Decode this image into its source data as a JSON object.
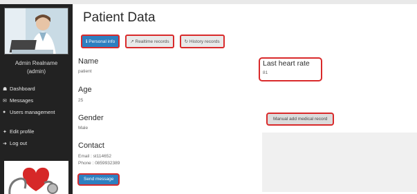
{
  "sidebar": {
    "admin_name_line1": "Admin Realname",
    "admin_name_line2": "(admin)",
    "items": [
      {
        "label": "Dashboard",
        "icon": "home-icon"
      },
      {
        "label": "Messages",
        "icon": "envelope-icon"
      },
      {
        "label": "Users management",
        "icon": "users-icon"
      },
      {
        "label": "Edit profile",
        "icon": "wrench-icon"
      },
      {
        "label": "Log out",
        "icon": "logout-icon"
      }
    ]
  },
  "main": {
    "title": "Patient Data",
    "tabs": [
      {
        "label": "Personal info",
        "icon": "info-icon",
        "active": true
      },
      {
        "label": "Realtime records",
        "icon": "chart-icon",
        "active": false
      },
      {
        "label": "History records",
        "icon": "history-icon",
        "active": false
      }
    ],
    "fields": {
      "name_label": "Name",
      "name_value": "patient",
      "age_label": "Age",
      "age_value": "25",
      "gender_label": "Gender",
      "gender_value": "Male",
      "contact_label": "Contact",
      "email_line": "Email : st114652",
      "phone_line": "Phone : 0859932389"
    },
    "send_button": "Send message",
    "last_heart_rate_label": "Last heart rate",
    "last_heart_rate_value": "81",
    "manual_add_button": "Manual add medical record"
  },
  "colors": {
    "sidebar_bg": "#222222",
    "primary_blue": "#2e7fc0",
    "highlight_red": "#d9292a",
    "panel_grey": "#f0f0f0"
  }
}
